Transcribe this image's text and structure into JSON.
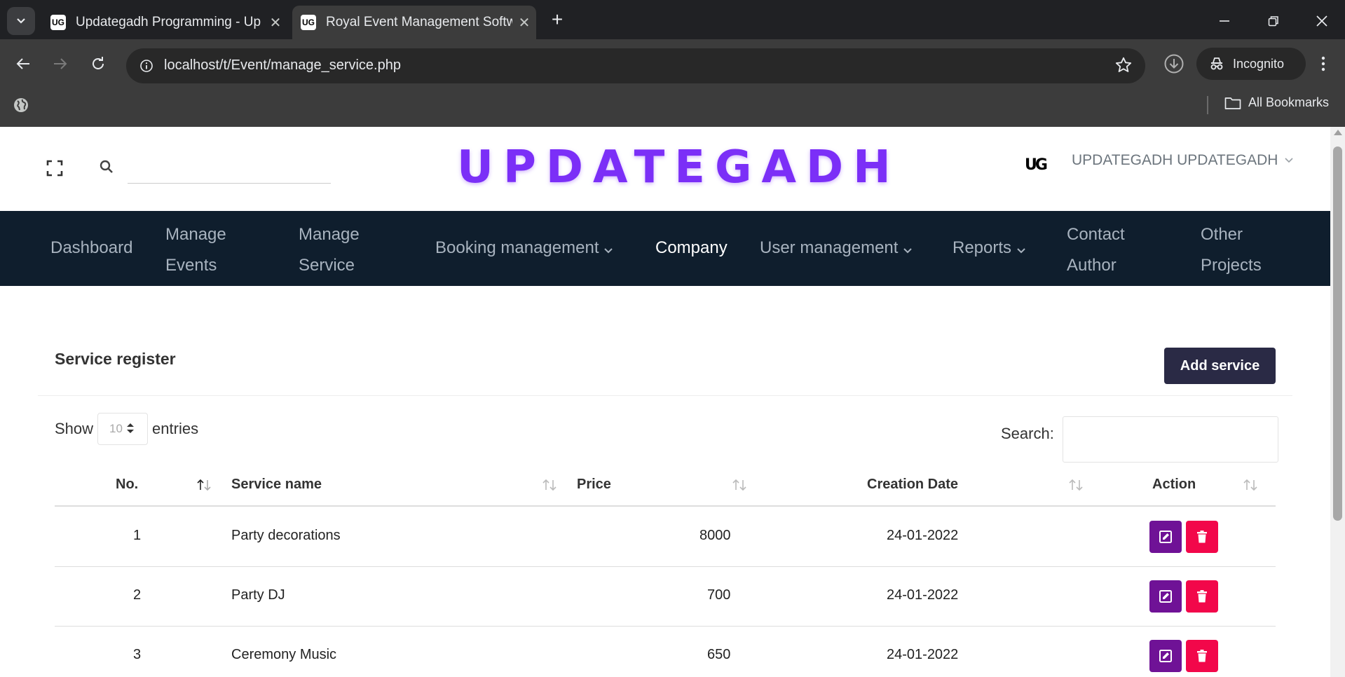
{
  "browser": {
    "tabs": [
      {
        "title": "Updategadh Programming - Up",
        "favicon": "UG",
        "active": false
      },
      {
        "title": "Royal Event Management Softw",
        "favicon": "UG",
        "active": true
      }
    ],
    "url": "localhost/t/Event/manage_service.php",
    "profile_label": "Incognito",
    "bookmarks_label": "All Bookmarks"
  },
  "header": {
    "search_value": "",
    "logo_text": "UPDATEGADH",
    "avatar_text": "UG",
    "user_name": "UPDATEGADH UPDATEGADH"
  },
  "nav": {
    "items": [
      {
        "line1": "Dashboard",
        "line2": ""
      },
      {
        "line1": "Manage",
        "line2": "Events"
      },
      {
        "line1": "Manage",
        "line2": "Service"
      },
      {
        "line1": "Booking management",
        "line2": "",
        "dropdown": true
      },
      {
        "line1": "Company",
        "line2": "",
        "active": true
      },
      {
        "line1": "User management",
        "line2": "",
        "dropdown": true
      },
      {
        "line1": "Reports",
        "line2": "",
        "dropdown": true
      },
      {
        "line1": "Contact",
        "line2": "Author"
      },
      {
        "line1": "Other",
        "line2": "Projects"
      }
    ]
  },
  "card": {
    "title": "Service register",
    "add_button": "Add service",
    "show_label": "Show",
    "entries_value": "10",
    "entries_label": "entries",
    "search_label": "Search:",
    "search_value": ""
  },
  "table": {
    "columns": [
      "No.",
      "Service name",
      "Price",
      "Creation Date",
      "Action"
    ],
    "rows": [
      {
        "no": "1",
        "name": "Party decorations",
        "price": "8000",
        "date": "24-01-2022"
      },
      {
        "no": "2",
        "name": "Party DJ",
        "price": "700",
        "date": "24-01-2022"
      },
      {
        "no": "3",
        "name": "Ceremony Music",
        "price": "650",
        "date": "24-01-2022"
      }
    ]
  },
  "colors": {
    "logo": "#7b2ff7",
    "nav_bg": "#0f1e2d",
    "add_button_bg": "#2a2a45",
    "edit_button": "#6f1296",
    "delete_button": "#f2074a"
  }
}
